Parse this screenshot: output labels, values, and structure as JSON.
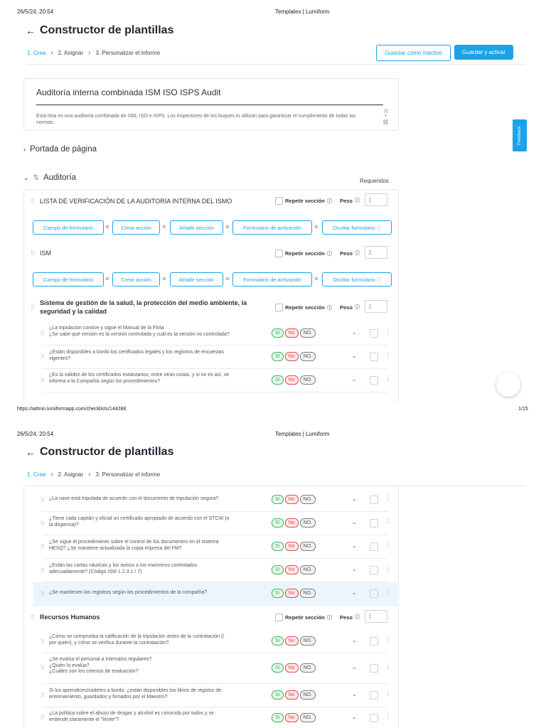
{
  "page1": {
    "print_date": "26/5/24, 20:54",
    "print_title": "Templates | Lumiform",
    "heading": "Constructor de plantillas",
    "back_icon": "←",
    "steps": [
      "1. Crea",
      "2. Asignar",
      "3. Personalizar el informe"
    ],
    "save_inactive": "Guardar como inactivo",
    "save_activate": "Guardar y activar",
    "doc_title": "Auditoría interna combinada ISM ISO ISPS Audit",
    "doc_description": "Esta lista es una auditoría combinada de ISM, ISO e ISPS. Los inspectores de los buques lo utilizan para garantizar el cumplimiento de todas las normas.",
    "cover_section": "Portada de página",
    "audit_section": "Auditoría",
    "required_label": "Requeridos",
    "feedback_label": "Feedback",
    "footer_url": "https://admin.lumiformapp.com/checklists/144288",
    "footer_page": "1/15"
  },
  "common": {
    "repeat_label": "Repetir sección",
    "weight_label": "Peso",
    "weight_value": "1",
    "sep": "o",
    "actions": [
      "Campo de formulario",
      "Crear acción",
      "Añadir sección",
      "Formulario de activación",
      "Ocultar formulario"
    ],
    "answers": {
      "yes": "Sí",
      "no": "No",
      "na": "NO."
    }
  },
  "sections_p1": [
    {
      "title": "LISTA DE VERIFICACIÓN DE LA AUDITORÍA INTERNA DEL ISMO"
    },
    {
      "title": "ISM"
    },
    {
      "title": "Sistema de gestión de la salud, la protección del medio ambiente, la seguridad y la calidad"
    }
  ],
  "questions_p1": [
    {
      "l1": "¿La tripulación conoce y sigue el Manual de la Flota",
      "l2": "¿Se sabe qué versión es la versión controlada y cuál es la versión no controlada?"
    },
    {
      "l1": "¿Están disponibles a bordo los certificados legales y los registros de encuestas",
      "l2": "vigentes?"
    },
    {
      "l1": "¿Es la validez de los certificados estatutarios, entre otras cosas, y si no es así, se",
      "l2": "informa a la Compañía según los procedimientos?"
    }
  ],
  "page2": {
    "print_date": "26/5/24, 20:54",
    "print_title": "Templates | Lumiform",
    "heading": "Constructor de plantillas",
    "steps": [
      "1. Crea",
      "2. Asignar",
      "3. Personalizar el informe"
    ],
    "hr_section": "Recursos Humanos"
  },
  "questions_p2a": [
    {
      "l1": "¿La nave está tripulada de acuerdo con el documento de tripulación segura?",
      "l2": ""
    },
    {
      "l1": "¿Tiene cada capitán y oficial un certificado apropiado de acuerdo con el STCW (o",
      "l2": "la dispensa)?"
    },
    {
      "l1": "¿Se sigue el procedimiento sobre el control de los documentos en el sistema",
      "l2": "HESQ? ¿Se mantiene actualizada la copia impresa del FM?"
    },
    {
      "l1": "¿Están las cartas náuticas y los avisos a los marineros controlados",
      "l2": "adecuadamente? (Código ISM 1.2.3.1 / 7)"
    },
    {
      "l1": "¿Se mantienen los registros según los procedimientos de la compañía?",
      "l2": ""
    }
  ],
  "questions_p2b": [
    {
      "l1": "¿Cómo se comprueba la calificación de la tripulación antes de la contratación (/",
      "l2": "por quién), y cómo se verifica durante la contratación?",
      "l3": ""
    },
    {
      "l1": "¿Se evalúa el personal a intervalos regulares?",
      "l2": "¿Quién lo evalúa?",
      "l3": "¿Cuáles son los criterios de evaluación?"
    },
    {
      "l1": "Si los aprendices/cadetes a bordo: ¿están disponibles los libros de registro de",
      "l2": "entrenamiento, guardados y firmados por el Maestro?",
      "l3": ""
    },
    {
      "l1": "¿La política sobre el abuso de drogas y alcohol es conocida por todos y se",
      "l2": "entiende claramente el \"límite\"?",
      "l3": ""
    }
  ]
}
